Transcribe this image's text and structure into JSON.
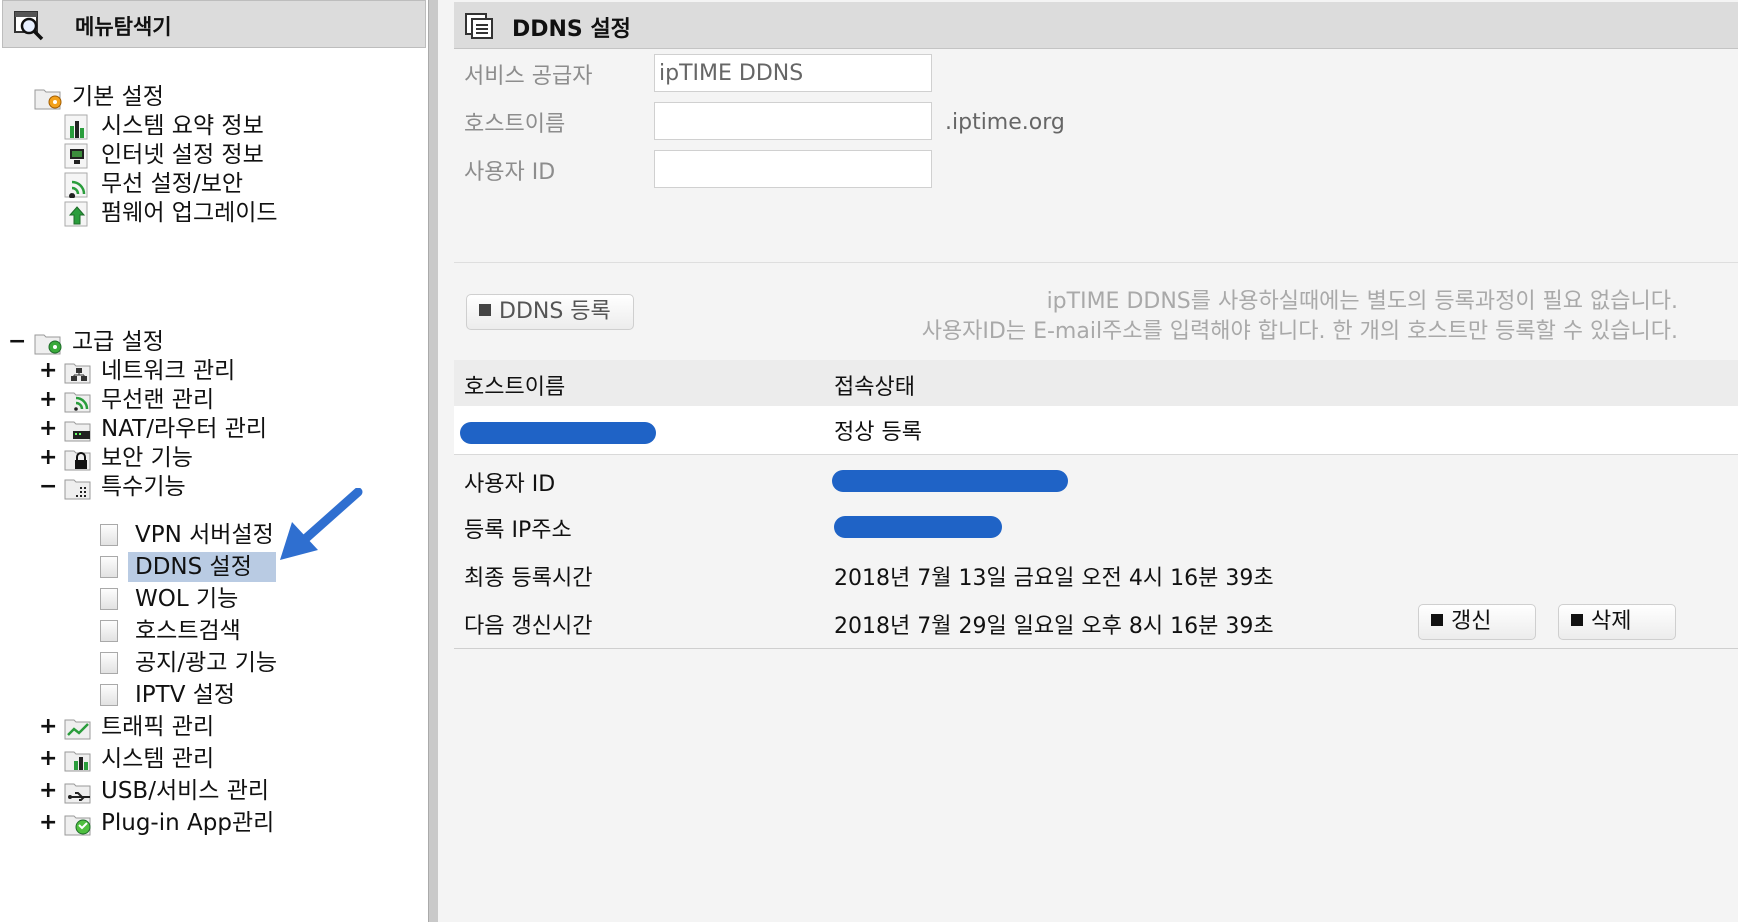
{
  "left_panel": {
    "title": "메뉴탐색기",
    "basic": {
      "label": "기본 설정",
      "items": [
        "시스템 요약 정보",
        "인터넷 설정 정보",
        "무선 설정/보안",
        "펌웨어 업그레이드"
      ]
    },
    "advanced": {
      "label": "고급 설정",
      "toggle": "−",
      "items": [
        {
          "label": "네트워크 관리",
          "toggle": "+"
        },
        {
          "label": "무선랜 관리",
          "toggle": "+"
        },
        {
          "label": "NAT/라우터 관리",
          "toggle": "+"
        },
        {
          "label": "보안 기능",
          "toggle": "+"
        },
        {
          "label": "특수기능",
          "toggle": "−"
        }
      ],
      "special_items": [
        "VPN 서버설정",
        "DDNS 설정",
        "WOL 기능",
        "호스트검색",
        "공지/광고 기능",
        "IPTV 설정"
      ],
      "selected": "DDNS 설정",
      "more_items": [
        {
          "label": "트래픽 관리",
          "toggle": "+"
        },
        {
          "label": "시스템 관리",
          "toggle": "+"
        },
        {
          "label": "USB/서비스 관리",
          "toggle": "+"
        },
        {
          "label": "Plug-in App관리",
          "toggle": "+"
        }
      ]
    }
  },
  "right_panel": {
    "title": "DDNS 설정",
    "form": {
      "provider_label": "서비스 공급자",
      "provider_value": "ipTIME DDNS",
      "hostname_label": "호스트이름",
      "hostname_value": "",
      "hostname_suffix": ".iptime.org",
      "userid_label": "사용자 ID",
      "userid_value": ""
    },
    "register_button": "DDNS 등록",
    "notice_line1": "ipTIME DDNS를 사용하실때에는 별도의 등록과정이 필요 없습니다.",
    "notice_line2": "사용자ID는 E-mail주소를 입력해야 합니다. 한 개의 호스트만 등록할 수 있습니다.",
    "table": {
      "col_hostname": "호스트이름",
      "col_status": "접속상태",
      "row_status": "정상 등록"
    },
    "details": {
      "userid_label": "사용자 ID",
      "ip_label": "등록 IP주소",
      "last_reg_label": "최종 등록시간",
      "last_reg_value": "2018년 7월 13일 금요일 오전 4시 16분 39초",
      "next_update_label": "다음 갱신시간",
      "next_update_value": "2018년 7월 29일 일요일 오후 8시 16분 39초"
    },
    "update_button": "갱신",
    "delete_button": "삭제"
  },
  "colors": {
    "header_bg": "#dcdcdc",
    "selection": "#b9cbe3",
    "redaction": "#1f63c6",
    "arrow": "#2f6fd0"
  }
}
